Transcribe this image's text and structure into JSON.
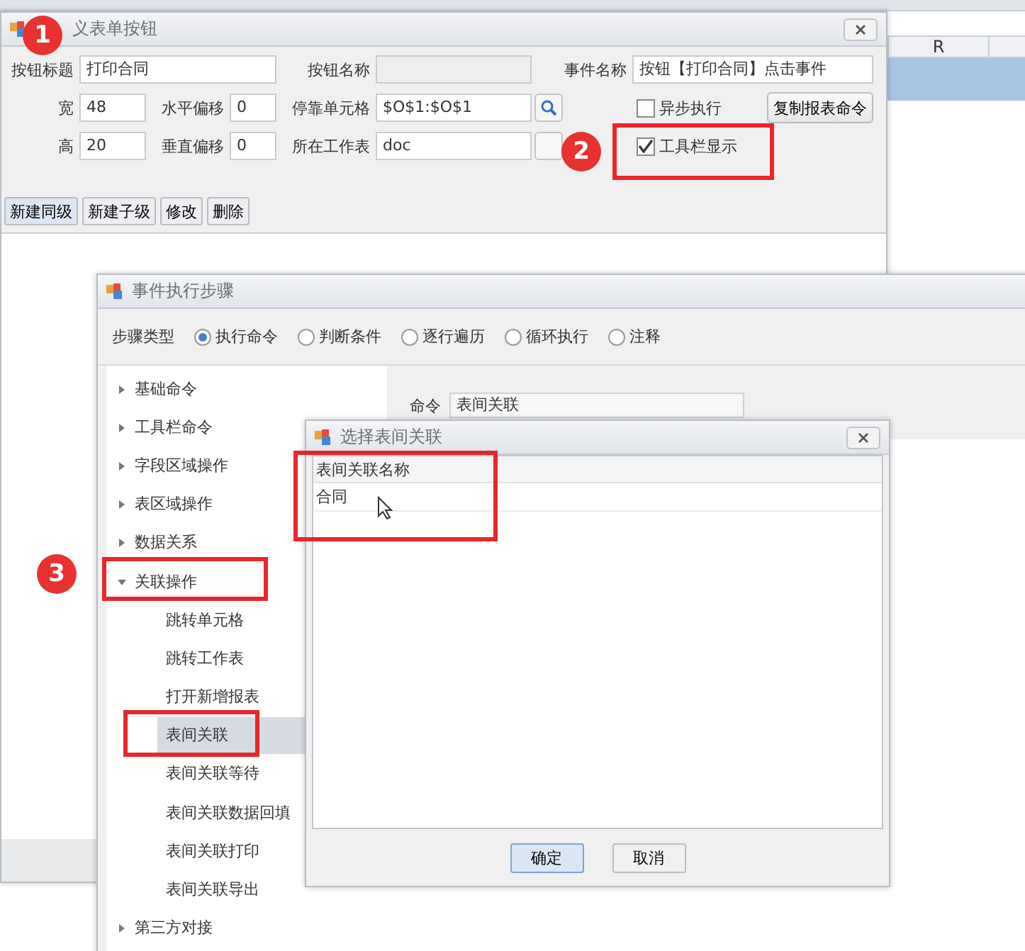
{
  "sheet": {
    "column_header": "R"
  },
  "form_window": {
    "title": "义表单按钮",
    "row1": [
      {
        "kind": "label",
        "text": "按钮标题"
      },
      {
        "kind": "input",
        "value": "打印合同",
        "disabled": false
      },
      {
        "kind": "label",
        "text": "按钮名称"
      },
      {
        "kind": "input",
        "disabled": true
      },
      {
        "kind": "label",
        "text": "事件名称"
      },
      {
        "kind": "input",
        "value": "按钮【打印合同】点击事件",
        "disabled": false
      }
    ],
    "row2": [
      {
        "kind": "label",
        "text": "宽"
      },
      {
        "kind": "input",
        "value": "48",
        "disabled": false
      },
      {
        "kind": "label",
        "text": "水平偏移"
      },
      {
        "kind": "input",
        "value": "0",
        "disabled": false
      },
      {
        "kind": "label",
        "text": "停靠单元格"
      },
      {
        "kind": "input",
        "value": "$O$1:$O$1",
        "disabled": false
      },
      {
        "kind": "search"
      },
      {
        "kind": "gap"
      },
      {
        "kind": "checkbox",
        "text": "异步执行",
        "checked": false
      },
      {
        "kind": "button",
        "text": "复制报表命令"
      }
    ],
    "row3": [
      {
        "kind": "label",
        "text": "高"
      },
      {
        "kind": "input",
        "value": "20",
        "disabled": false
      },
      {
        "kind": "label",
        "text": "垂直偏移"
      },
      {
        "kind": "input",
        "value": "0",
        "disabled": false
      },
      {
        "kind": "label",
        "text": "所在工作表"
      },
      {
        "kind": "input",
        "value": "doc",
        "disabled": false
      },
      {
        "kind": "picker"
      },
      {
        "kind": "gap"
      },
      {
        "kind": "checkbox",
        "text": "工具栏显示",
        "checked": true
      }
    ],
    "buttons": [
      "新建同级",
      "新建子级",
      "修改",
      "删除"
    ]
  },
  "steps_window": {
    "title": "事件执行步骤",
    "step_type_label": "步骤类型",
    "step_types": [
      {
        "label": "执行命令",
        "selected": true
      },
      {
        "label": "判断条件",
        "selected": false
      },
      {
        "label": "逐行遍历",
        "selected": false
      },
      {
        "label": "循环执行",
        "selected": false
      },
      {
        "label": "注释",
        "selected": false
      }
    ],
    "tree": [
      {
        "label": "基础命令",
        "expanded": false,
        "selected": false
      },
      {
        "label": "工具栏命令",
        "expanded": false,
        "selected": false
      },
      {
        "label": "字段区域操作",
        "expanded": false,
        "selected": false
      },
      {
        "label": "表区域操作",
        "expanded": false,
        "selected": false
      },
      {
        "label": "数据关系",
        "expanded": false,
        "selected": false
      },
      {
        "label": "关联操作",
        "expanded": true,
        "selected": false,
        "children": [
          {
            "label": "跳转单元格",
            "selected": false
          },
          {
            "label": "跳转工作表",
            "selected": false
          },
          {
            "label": "打开新增报表",
            "selected": false
          },
          {
            "label": "表间关联",
            "selected": true
          },
          {
            "label": "表间关联等待",
            "selected": false
          },
          {
            "label": "表间关联数据回填",
            "selected": false
          },
          {
            "label": "表间关联打印",
            "selected": false
          },
          {
            "label": "表间关联导出",
            "selected": false
          }
        ]
      },
      {
        "label": "第三方对接",
        "expanded": false,
        "selected": false
      }
    ],
    "command": {
      "label": "命令",
      "value": "表间关联"
    }
  },
  "select_window": {
    "title": "选择表间关联",
    "column": "表间关联名称",
    "rows": [
      {
        "name": "合同",
        "selected": false
      }
    ],
    "buttons": [
      {
        "label": "确定",
        "focused": true
      },
      {
        "label": "取消",
        "focused": false
      }
    ]
  },
  "badges": [
    "1",
    "2",
    "3"
  ]
}
